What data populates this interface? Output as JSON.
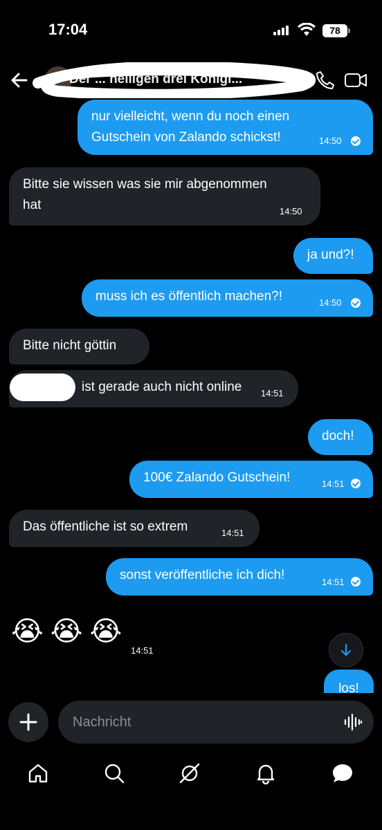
{
  "status": {
    "time": "17:04",
    "battery": "78"
  },
  "header": {
    "contact_name": "Der ... heiligen drei Königi..."
  },
  "messages": [
    {
      "dir": "sent",
      "text_lines": [
        "nur vielleicht, wenn du noch einen",
        "Gutschein von Zalando schickst!"
      ],
      "time": "14:50",
      "read": true
    },
    {
      "dir": "recv",
      "text_lines": [
        "Bitte sie wissen was sie mir abgenommen",
        "hat"
      ],
      "time": "14:50"
    },
    {
      "dir": "sent",
      "text": "ja und?!"
    },
    {
      "dir": "sent",
      "text": "muss ich es öffentlich machen?!",
      "time": "14:50",
      "read": true
    },
    {
      "dir": "recv",
      "text": "Bitte nicht göttin"
    },
    {
      "dir": "recv",
      "text": "ist gerade auch nicht online",
      "time": "14:51"
    },
    {
      "dir": "sent",
      "text": "doch!"
    },
    {
      "dir": "sent",
      "text": "100€ Zalando Gutschein!",
      "time": "14:51",
      "read": true
    },
    {
      "dir": "recv",
      "text": "Das öffentliche ist so extrem",
      "time": "14:51"
    },
    {
      "dir": "sent",
      "text": "sonst veröffentliche ich dich!",
      "time": "14:51",
      "read": true
    },
    {
      "dir": "recv",
      "emoji": "😭😭😭",
      "time": "14:51"
    },
    {
      "dir": "sent",
      "text": "los!"
    }
  ],
  "composer": {
    "placeholder": "Nachricht"
  },
  "nav": [
    "home-icon",
    "search-icon",
    "grok-icon",
    "notifications-icon",
    "messages-icon"
  ],
  "colors": {
    "accent": "#1d9bf0",
    "received_bubble": "#202327"
  }
}
